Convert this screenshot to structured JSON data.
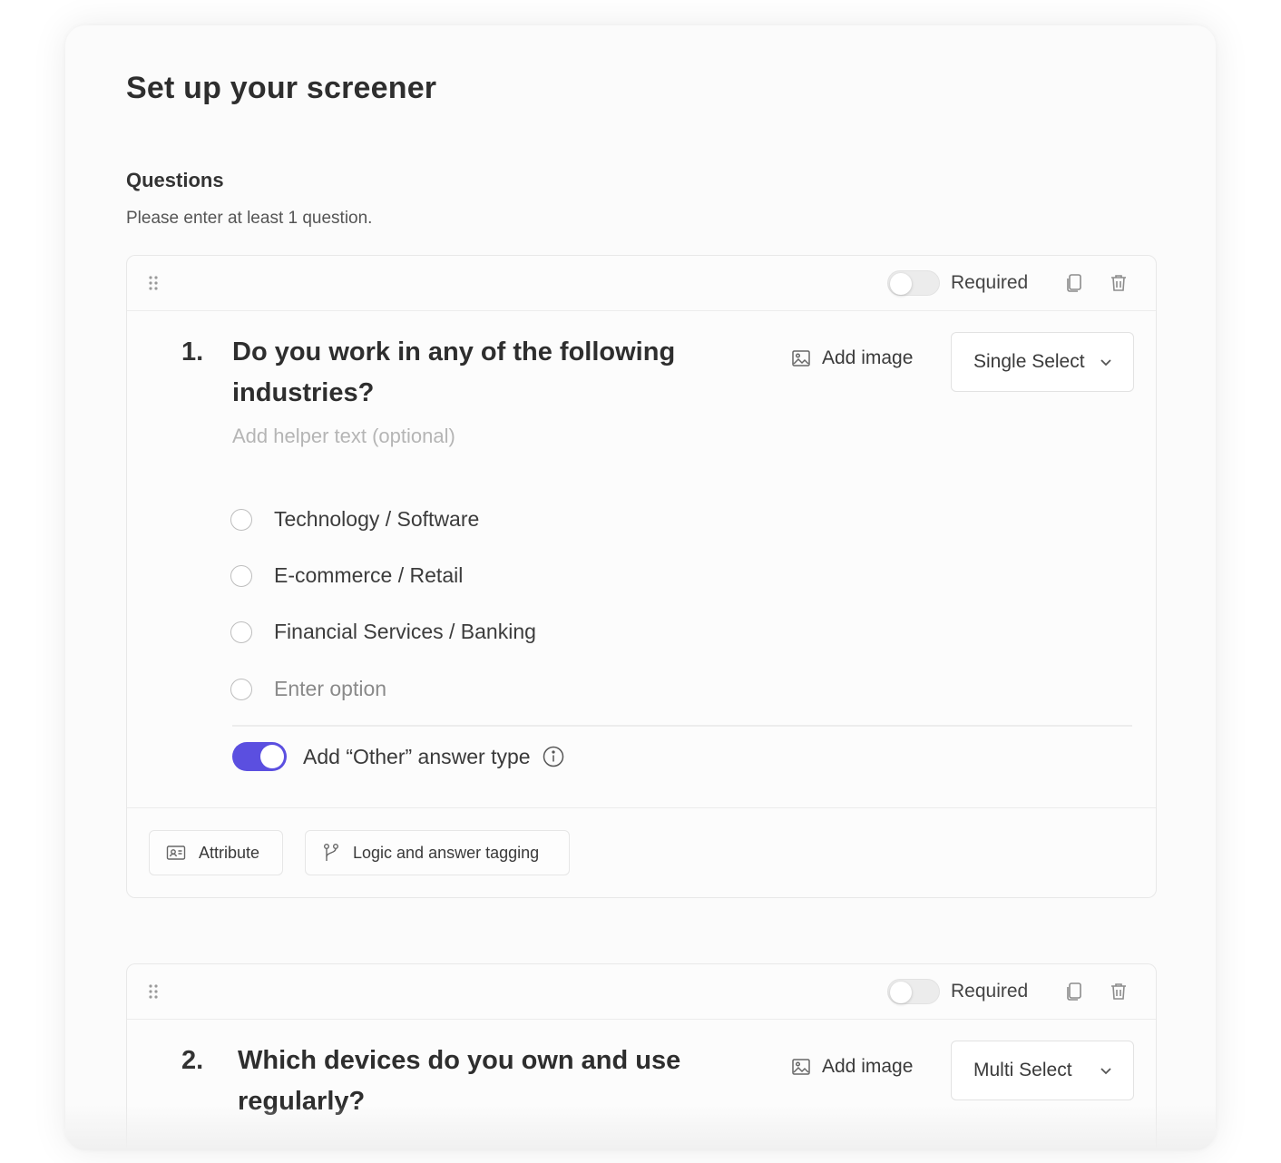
{
  "page": {
    "title": "Set up your screener",
    "section_title": "Questions",
    "section_subtitle": "Please enter at least 1 question."
  },
  "questions": [
    {
      "number": "1.",
      "text": "Do you work in any of the following industries?",
      "required_label": "Required",
      "required": false,
      "add_image_label": "Add image",
      "type_label": "Single Select",
      "helper_placeholder": "Add helper text (optional)",
      "options": [
        {
          "label": "Technology / Software"
        },
        {
          "label": "E-commerce / Retail"
        },
        {
          "label": "Financial Services / Banking"
        }
      ],
      "option_placeholder": "Enter option",
      "other_label": "Add “Other” answer type",
      "other_enabled": true,
      "attribute_label": "Attribute",
      "logic_label": "Logic and answer tagging"
    },
    {
      "number": "2.",
      "text": "Which devices do you own and use regularly?",
      "required_label": "Required",
      "required": false,
      "add_image_label": "Add image",
      "type_label": "Multi Select"
    }
  ],
  "colors": {
    "accent": "#5b4fe0",
    "text_primary": "#2e2e2e",
    "text_muted": "#b5b5b5",
    "border": "#e8e8e8"
  }
}
